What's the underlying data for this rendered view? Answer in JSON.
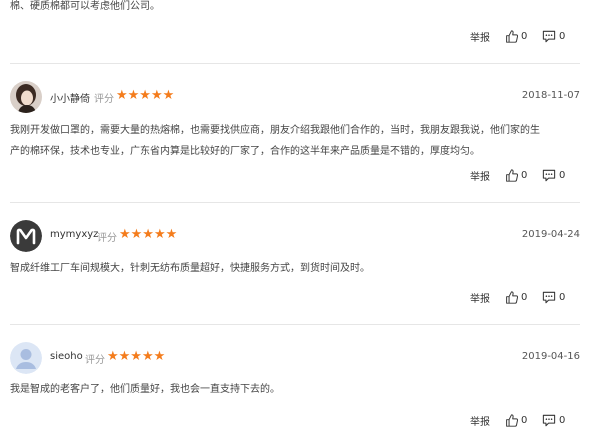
{
  "top_text": "棉、硬质棉都可以考虑他们公司。",
  "actions": {
    "report_label": "举报",
    "like_count": "0",
    "comment_count": "0"
  },
  "score_label": "评分",
  "stars": "★★★★★",
  "reviews": [
    {
      "username": "小小静倚",
      "date": "2018-11-07",
      "text_line1": "我刚开发做口罩的，需要大量的热熔棉，也需要找供应商，朋友介绍我跟他们合作的，当时，我朋友跟我说，他们家的生",
      "text_line2": "产的棉环保，技术也专业，广东省内算是比较好的厂家了，合作的这半年来产品质量是不错的，厚度均匀。"
    },
    {
      "username": "mymyxyz",
      "date": "2019-04-24",
      "text_line1": "智成纤维工厂车间规模大，针刺无纺布质量超好，快捷服务方式，到货时间及时。"
    },
    {
      "username": "sieoho",
      "date": "2019-04-16",
      "text_line1": "我是智成的老客户了，他们质量好，我也会一直支持下去的。"
    }
  ],
  "colors": {
    "star": "#f47c1c",
    "divider": "#e6e6e6"
  }
}
